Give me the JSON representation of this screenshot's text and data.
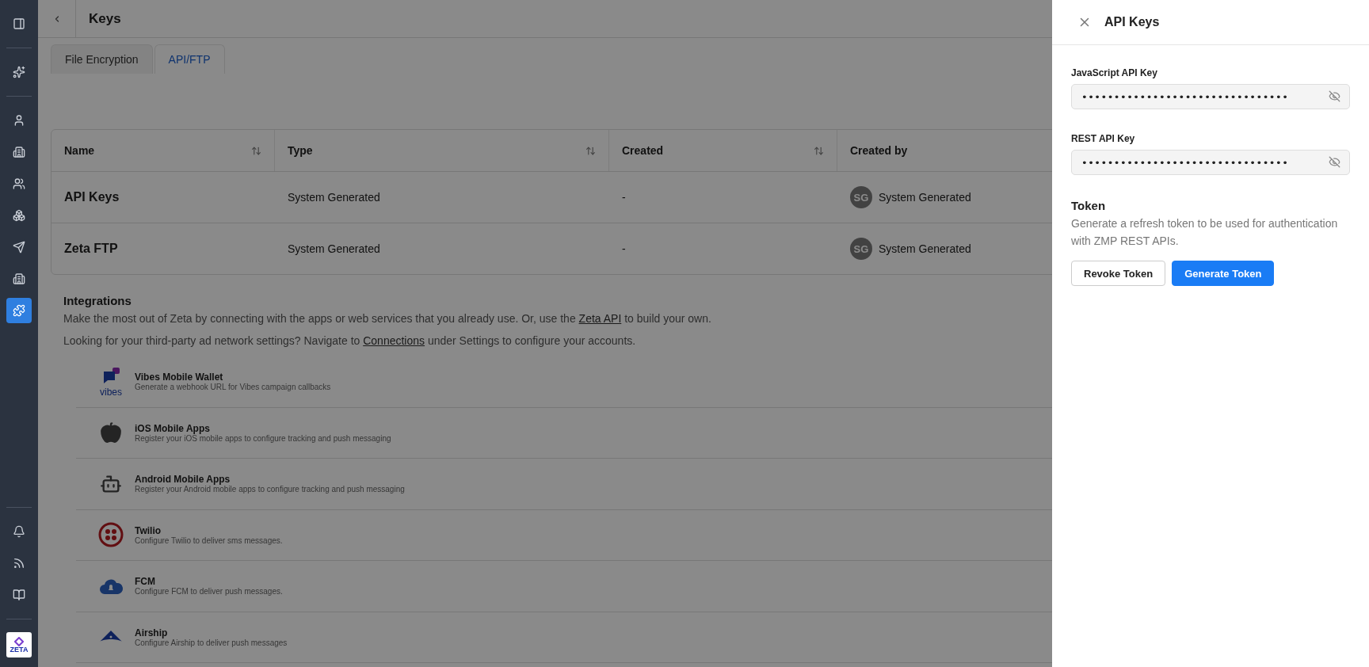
{
  "sidebar": {
    "top_items": [
      {
        "kind": "sparkles",
        "selected": false
      }
    ],
    "nav_items": [
      {
        "kind": "user",
        "selected": false
      },
      {
        "kind": "building",
        "selected": false
      },
      {
        "kind": "users",
        "selected": false
      },
      {
        "kind": "cluster",
        "selected": false
      },
      {
        "kind": "send",
        "selected": false
      },
      {
        "kind": "building",
        "selected": false
      },
      {
        "kind": "puzzle",
        "selected": true
      }
    ],
    "bottom_items": [
      {
        "kind": "bell",
        "selected": false
      },
      {
        "kind": "signal",
        "selected": false
      },
      {
        "kind": "book",
        "selected": false
      }
    ],
    "logo": "ZETA"
  },
  "header": {
    "title": "Keys"
  },
  "tabs": [
    {
      "label": "File Encryption",
      "selected": false
    },
    {
      "label": "API/FTP",
      "selected": true
    }
  ],
  "table": {
    "columns": [
      {
        "label": "Name",
        "sortable": true
      },
      {
        "label": "Type",
        "sortable": true
      },
      {
        "label": "Created",
        "sortable": true
      },
      {
        "label": "Created by"
      }
    ],
    "rows": [
      {
        "name": "API Keys",
        "type": "System Generated",
        "created": "-",
        "avatar": "SG",
        "created_by": "System Generated"
      },
      {
        "name": "Zeta FTP",
        "type": "System Generated",
        "created": "-",
        "avatar": "SG",
        "created_by": "System Generated"
      }
    ]
  },
  "integrations": {
    "title": "Integrations",
    "intro": {
      "before": "Make the most out of Zeta by connecting with the apps or web services that you already use. Or, use the ",
      "link": "Zeta API",
      "after": " to build your own."
    },
    "note": {
      "before": "Looking for your third-party ad network settings? Navigate to ",
      "link": "Connections",
      "after": " under Settings to configure your accounts."
    },
    "items": [
      {
        "kind": "vibes",
        "name": "Vibes Mobile Wallet",
        "description": "Generate a webhook URL for Vibes campaign callbacks",
        "logo_text": "vibes"
      },
      {
        "kind": "apple",
        "name": "iOS Mobile Apps",
        "description": "Register your iOS mobile apps to configure tracking and push messaging"
      },
      {
        "kind": "android",
        "name": "Android Mobile Apps",
        "description": "Register your Android mobile apps to configure tracking and push messaging"
      },
      {
        "kind": "twilio",
        "name": "Twilio",
        "description": "Configure Twilio to deliver sms messages."
      },
      {
        "kind": "fcm",
        "name": "FCM",
        "description": "Configure FCM to deliver push messages."
      },
      {
        "kind": "airship",
        "name": "Airship",
        "description": "Configure Airship to deliver push messages"
      }
    ]
  },
  "panel": {
    "title": "API Keys",
    "fields": [
      {
        "label": "JavaScript API Key",
        "value": "••••••••••••••••••••••••••••••••"
      },
      {
        "label": "REST API Key",
        "value": "••••••••••••••••••••••••••••••••"
      }
    ],
    "token": {
      "title": "Token",
      "description": "Generate a refresh token to be used for authentication with ZMP REST APIs.",
      "buttons": [
        {
          "label": "Revoke Token",
          "kind": "secondary"
        },
        {
          "label": "Generate Token",
          "kind": "primary"
        }
      ]
    }
  }
}
